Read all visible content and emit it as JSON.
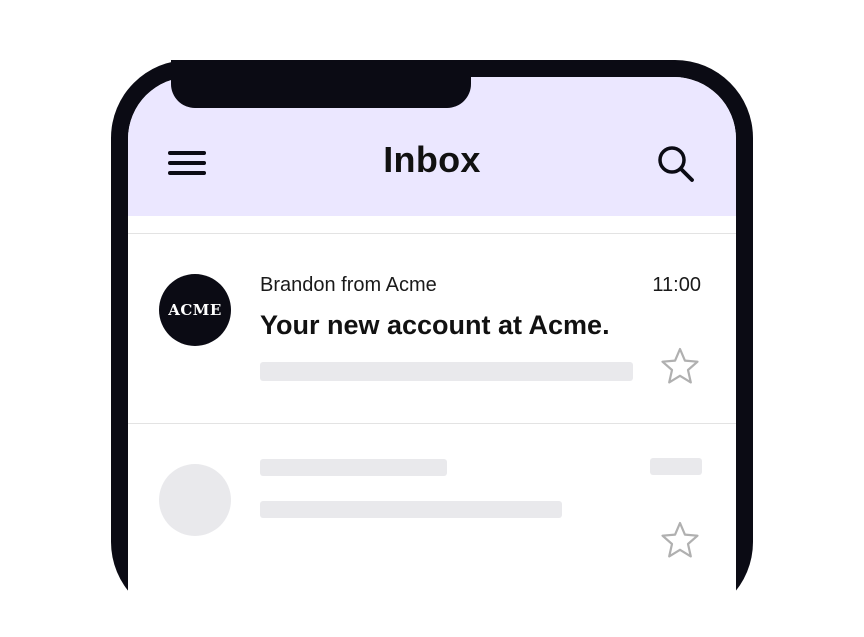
{
  "header": {
    "title": "Inbox",
    "menu_icon": "hamburger-menu-icon",
    "search_icon": "search-icon",
    "background": "#ebe7ff"
  },
  "emails": [
    {
      "avatar_text": "ACME",
      "sender": "Brandon from Acme",
      "time": "11:00",
      "subject": "Your new account at Acme.",
      "starred": false
    }
  ],
  "colors": {
    "frame": "#0b0b14",
    "skeleton": "#e9e9ec",
    "star": "#b0b0b0"
  }
}
